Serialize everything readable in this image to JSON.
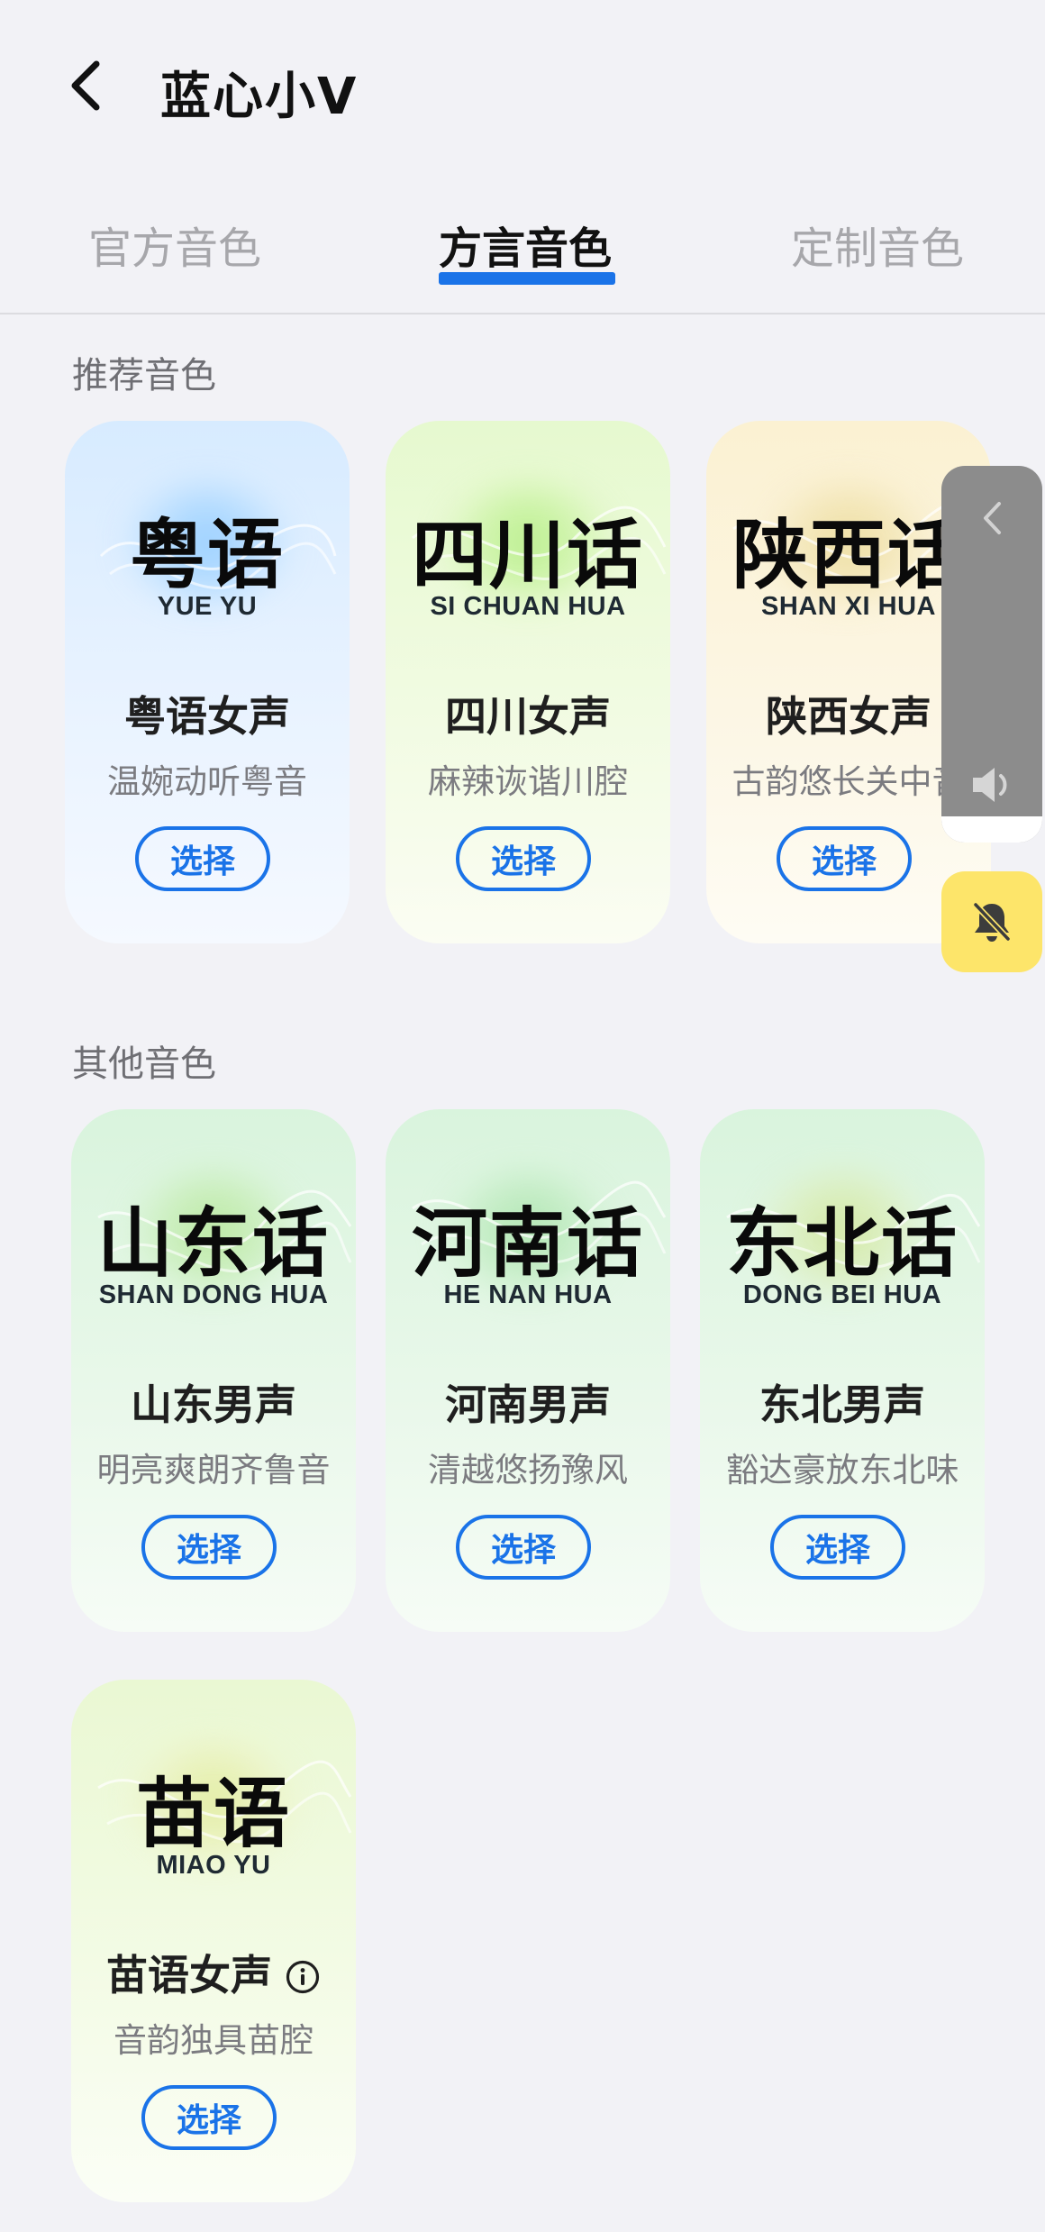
{
  "header": {
    "title": "蓝心小V",
    "back_icon": "chevron-left-icon"
  },
  "tabs": [
    {
      "label": "官方音色",
      "active": false
    },
    {
      "label": "方言音色",
      "active": true
    },
    {
      "label": "定制音色",
      "active": false
    }
  ],
  "accent_color": "#1a73e8",
  "sections": {
    "recommended": {
      "title": "推荐音色",
      "cards": [
        {
          "dialect": "粤语",
          "pinyin": "YUE YU",
          "voice": "粤语女声",
          "desc": "温婉动听粤音",
          "button": "选择",
          "theme": "blue"
        },
        {
          "dialect": "四川话",
          "pinyin": "SI CHUAN HUA",
          "voice": "四川女声",
          "desc": "麻辣诙谐川腔",
          "button": "选择",
          "theme": "lime"
        },
        {
          "dialect": "陕西话",
          "pinyin": "SHAN XI HUA",
          "voice": "陕西女声",
          "desc": "古韵悠长关中音",
          "button": "选择",
          "theme": "cream"
        }
      ]
    },
    "other": {
      "title": "其他音色",
      "cards": [
        {
          "dialect": "山东话",
          "pinyin": "SHAN DONG HUA",
          "voice": "山东男声",
          "desc": "明亮爽朗齐鲁音",
          "button": "选择",
          "theme": "green"
        },
        {
          "dialect": "河南话",
          "pinyin": "HE NAN HUA",
          "voice": "河南男声",
          "desc": "清越悠扬豫风",
          "button": "选择",
          "theme": "green"
        },
        {
          "dialect": "东北话",
          "pinyin": "DONG BEI HUA",
          "voice": "东北男声",
          "desc": "豁达豪放东北味",
          "button": "选择",
          "theme": "green"
        },
        {
          "dialect": "苗语",
          "pinyin": "MIAO YU",
          "voice": "苗语女声",
          "desc": "音韵独具苗腔",
          "button": "选择",
          "theme": "lime",
          "info_icon": "info-icon"
        }
      ]
    }
  },
  "overlay": {
    "collapse_icon": "chevron-left-icon",
    "volume_icon": "speaker-icon",
    "volume_level": 0.07,
    "mute_icon": "bell-off-icon"
  }
}
